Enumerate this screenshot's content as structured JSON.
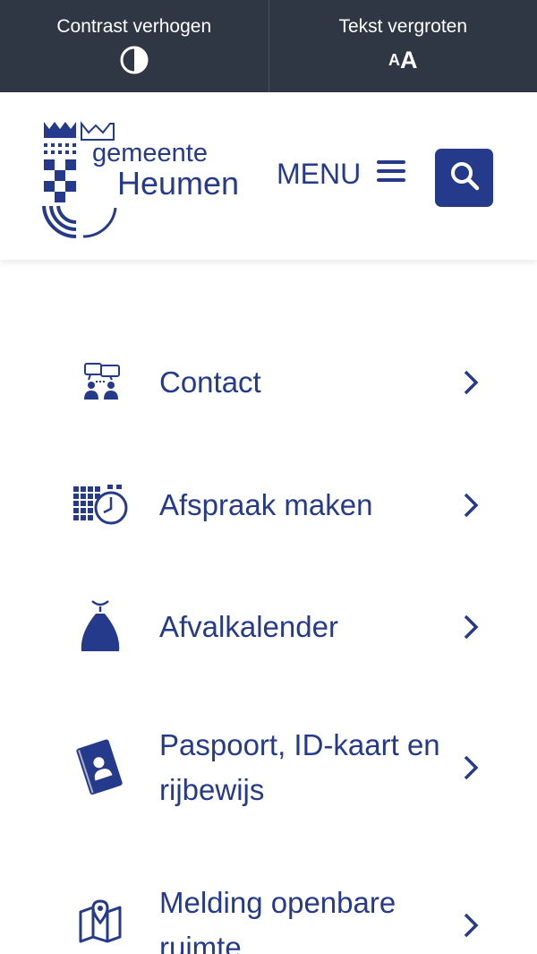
{
  "topbar": {
    "contrast_label": "Contrast verhogen",
    "textsize_label": "Tekst vergroten",
    "textsize_small": "A",
    "textsize_big": "A"
  },
  "header": {
    "logo_line1": "gemeente",
    "logo_line2": "Heumen",
    "menu_label": "MENU"
  },
  "nav": {
    "items": [
      {
        "label": "Contact",
        "icon": "contact-icon"
      },
      {
        "label": "Afspraak maken",
        "icon": "calendar-clock-icon"
      },
      {
        "label": "Afvalkalender",
        "icon": "waste-bag-icon"
      },
      {
        "label": "Paspoort, ID-kaart en rijbewijs",
        "icon": "passport-icon"
      },
      {
        "label": "Melding openbare ruimte",
        "icon": "map-pin-icon"
      }
    ]
  },
  "colors": {
    "brand": "#263a8c",
    "topbar_bg": "#2e3743",
    "page_bg": "#ffffff"
  }
}
